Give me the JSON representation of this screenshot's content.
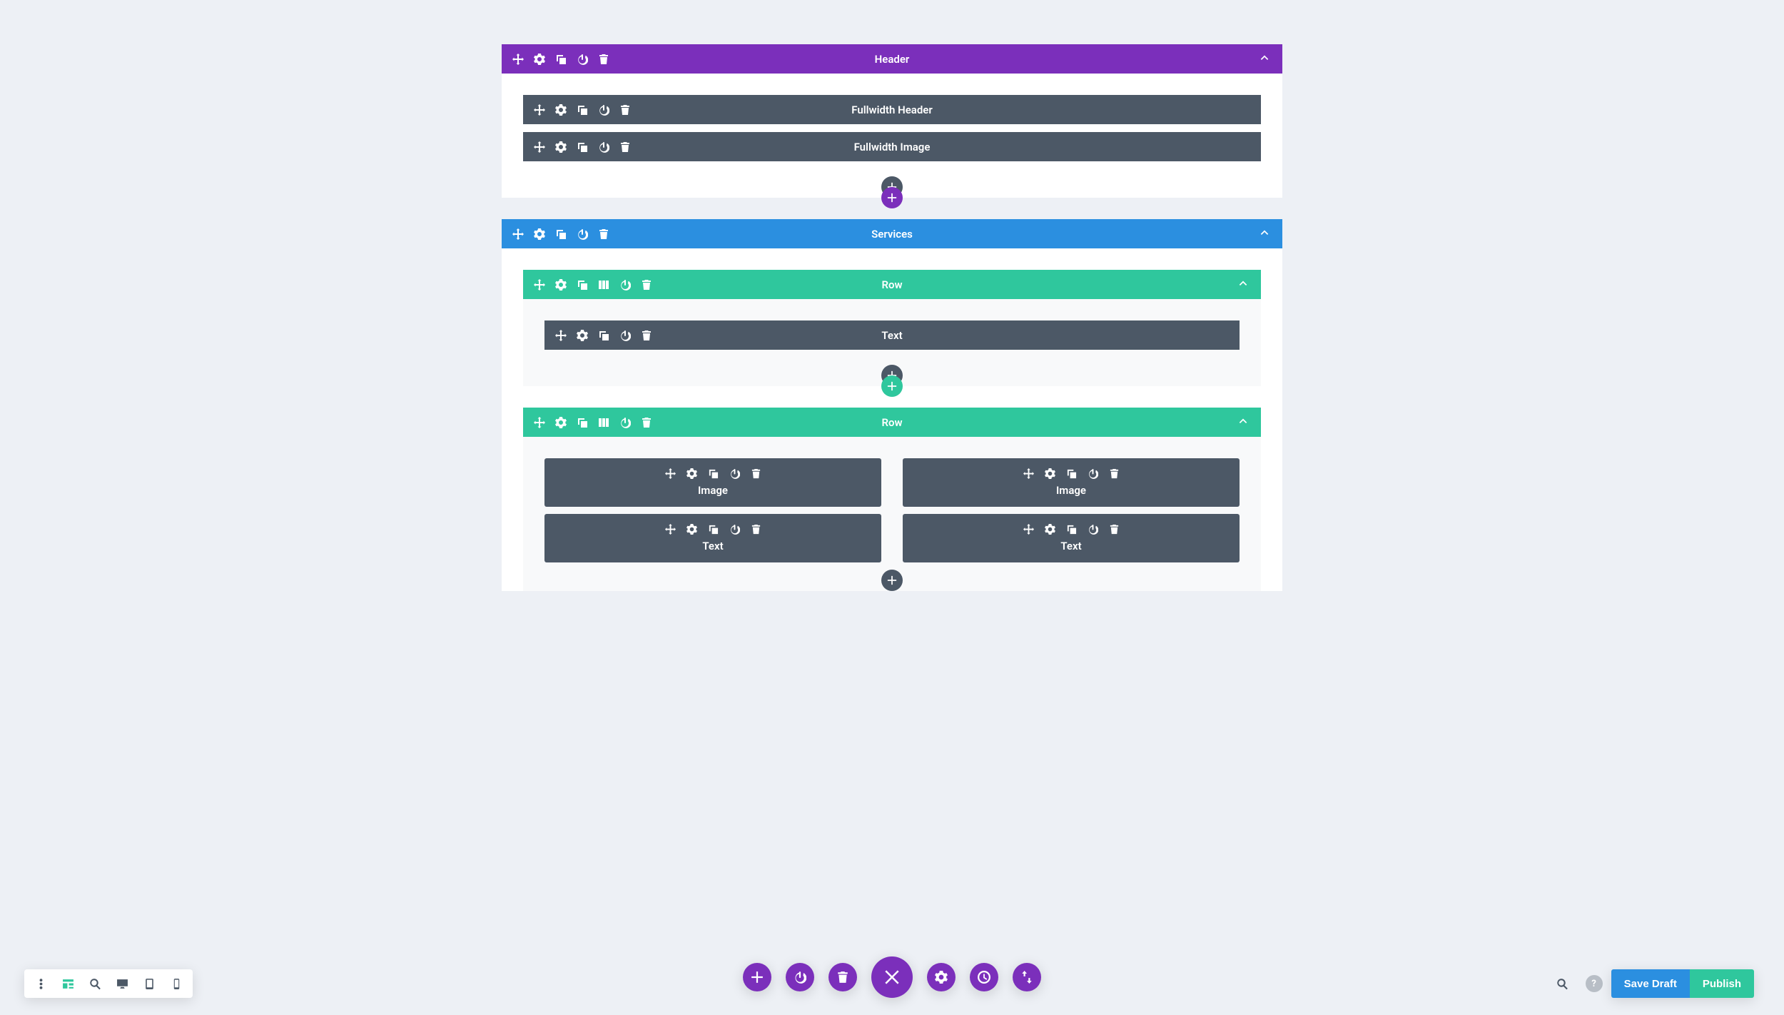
{
  "colors": {
    "purple": "#7b2fbb",
    "blue": "#2b8fe0",
    "teal": "#2fc79d",
    "dark": "#4c5866",
    "bg": "#edf0f5"
  },
  "sections": [
    {
      "id": "header",
      "color": "purple",
      "label": "Header",
      "modules": [
        {
          "label": "Fullwidth Header"
        },
        {
          "label": "Fullwidth Image"
        }
      ]
    },
    {
      "id": "services",
      "color": "blue",
      "label": "Services",
      "rows": [
        {
          "label": "Row",
          "columns": [
            [
              {
                "label": "Text"
              }
            ]
          ]
        },
        {
          "label": "Row",
          "columns": [
            [
              {
                "label": "Image"
              },
              {
                "label": "Text"
              }
            ],
            [
              {
                "label": "Image"
              },
              {
                "label": "Text"
              }
            ]
          ]
        }
      ]
    }
  ],
  "dock": {
    "left_icons": [
      "menu",
      "wireframe",
      "zoom",
      "desktop",
      "tablet",
      "phone"
    ],
    "center_icons": [
      "plus",
      "power",
      "trash",
      "close",
      "gear",
      "clock",
      "updown"
    ],
    "help": "?",
    "save_draft": "Save Draft",
    "publish": "Publish"
  }
}
